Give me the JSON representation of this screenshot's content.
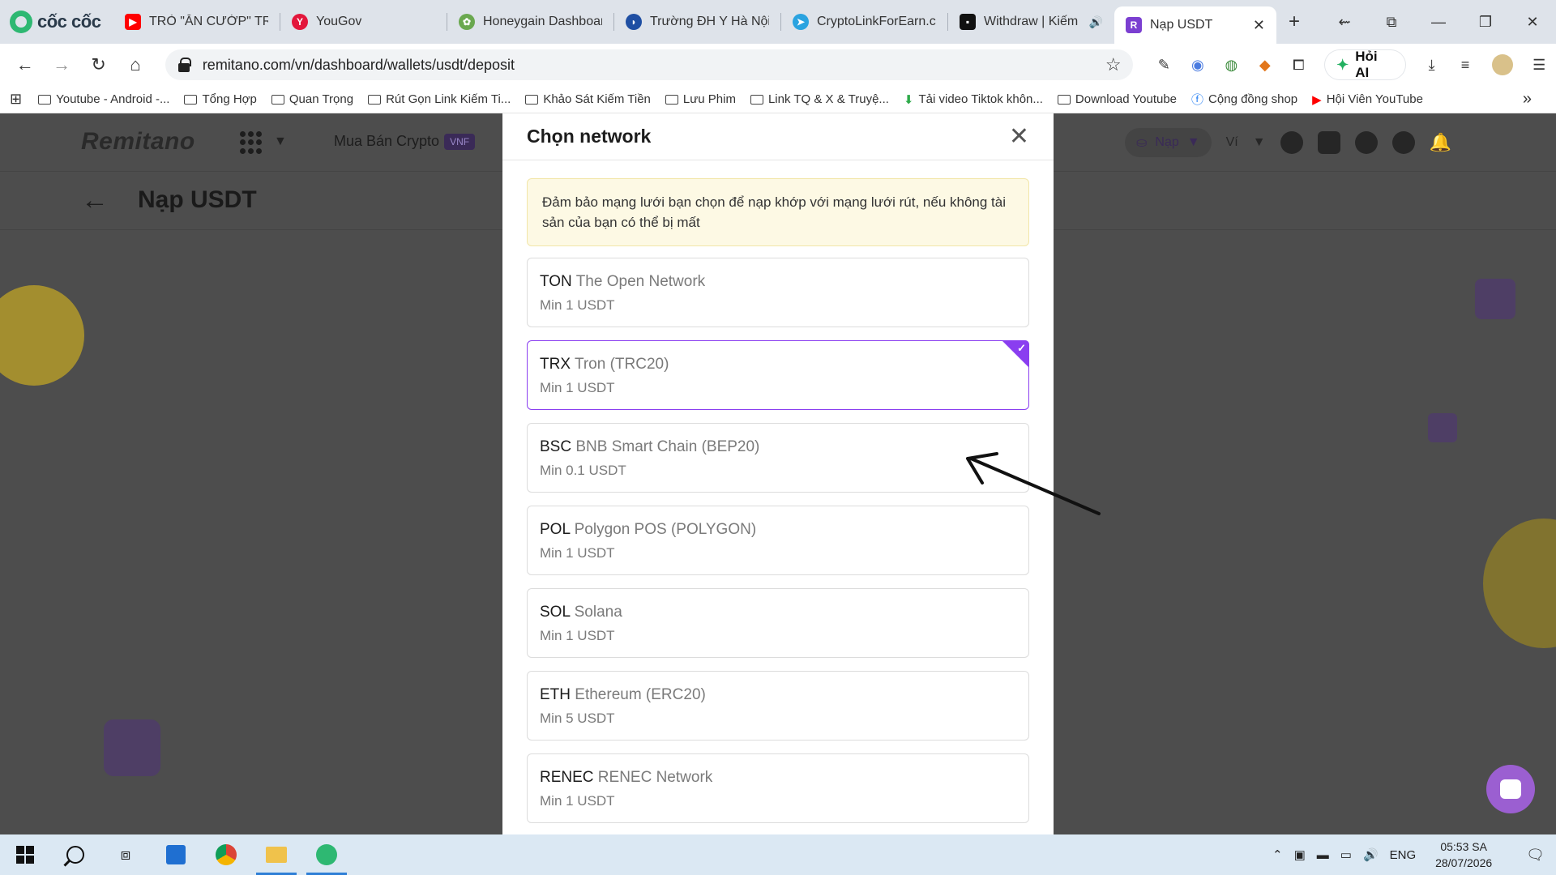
{
  "browser": {
    "brand": "cốc cốc",
    "tabs": [
      {
        "label": "TRÒ \"ĂN CƯỚP\" TRẮ",
        "color": "#ff0000"
      },
      {
        "label": "YouGov",
        "color": "#e3163b"
      },
      {
        "label": "Honeygain Dashboar",
        "color": "#6aa84f"
      },
      {
        "label": "Trường ĐH Y Hà Nội",
        "color": "#1f4fa3"
      },
      {
        "label": "CryptoLinkForEarn.co",
        "color": "#2aa3e0"
      },
      {
        "label": "Withdraw | Kiếm t",
        "color": "#111111"
      },
      {
        "label": "Nạp USDT",
        "color": "#7b3fd1"
      }
    ],
    "url": "remitano.com/vn/dashboard/wallets/usdt/deposit",
    "ask_ai": "Hỏi AI",
    "bookmarks": [
      "Youtube - Android -...",
      "Tổng Hợp",
      "Quan Trọng",
      "Rút Gọn Link Kiếm Ti...",
      "Khảo Sát Kiếm Tiền",
      "Lưu Phim",
      "Link TQ & X & Truyệ...",
      "Tải video Tiktok khôn...",
      "Download Youtube",
      "Cộng đồng shop",
      "Hội Viên YouTube"
    ]
  },
  "app": {
    "logo": "Remitano",
    "buy_crypto": "Mua Bán Crypto",
    "vnf_badge": "VNF",
    "deposit_menu": "Nạp",
    "wallet_menu": "Ví",
    "page_title": "Nạp USDT"
  },
  "modal": {
    "title": "Chọn network",
    "notice": "Đảm bảo mạng lưới bạn chọn để nạp khớp với mạng lưới rút, nếu không tài sản của bạn có thể bị mất",
    "networks": [
      {
        "code": "TON",
        "name": "The Open Network",
        "min": "Min 1 USDT",
        "selected": false
      },
      {
        "code": "TRX",
        "name": "Tron (TRC20)",
        "min": "Min 1 USDT",
        "selected": true
      },
      {
        "code": "BSC",
        "name": "BNB Smart Chain (BEP20)",
        "min": "Min 0.1 USDT",
        "selected": false
      },
      {
        "code": "POL",
        "name": "Polygon POS (POLYGON)",
        "min": "Min 1 USDT",
        "selected": false
      },
      {
        "code": "SOL",
        "name": "Solana",
        "min": "Min 1 USDT",
        "selected": false
      },
      {
        "code": "ETH",
        "name": "Ethereum (ERC20)",
        "min": "Min 5 USDT",
        "selected": false
      },
      {
        "code": "RENEC",
        "name": "RENEC Network",
        "min": "Min 1 USDT",
        "selected": false
      }
    ],
    "accent_color": "#8a3ef0"
  },
  "taskbar": {
    "language": "ENG",
    "time": "05:53 SA",
    "date": "28/07/2026"
  }
}
